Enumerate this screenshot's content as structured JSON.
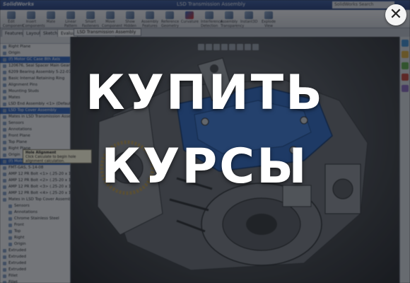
{
  "app": {
    "brand": "SolidWorks",
    "window_title": "LSD Transmission Assembly",
    "search_placeholder": "SolidWorks Search"
  },
  "toolbar": {
    "tools": [
      {
        "label": "Edit Component",
        "active": false
      },
      {
        "label": "Insert Components",
        "active": false
      },
      {
        "label": "Mate",
        "active": false
      },
      {
        "label": "Linear Pattern",
        "active": false
      },
      {
        "label": "Smart Fasteners",
        "active": false
      },
      {
        "label": "Move Component",
        "active": false
      },
      {
        "label": "Show Hidden",
        "active": false
      },
      {
        "label": "Assembly Features",
        "active": false
      },
      {
        "label": "Reference Geometry",
        "active": false
      },
      {
        "label": "Curvature",
        "active": true
      },
      {
        "label": "Interference Detection",
        "active": false
      },
      {
        "label": "Assembly Transparency",
        "active": false
      },
      {
        "label": "Instant3D",
        "active": false
      },
      {
        "label": "Explode View",
        "active": false
      }
    ]
  },
  "panel_tabs": [
    "Features",
    "Layout",
    "Sketch",
    "Evaluate",
    "Office Products"
  ],
  "panel_tab_selected": "Evaluate",
  "document_tab": "LSD Transmission Assembly",
  "tree": {
    "items": [
      {
        "label": "Right Plane",
        "selected": false,
        "indent": false
      },
      {
        "label": "Origin",
        "selected": false,
        "indent": false
      },
      {
        "label": "(f) Motor GC Case 8th Axis",
        "selected": true,
        "indent": false
      },
      {
        "label": "120676, Seal Spacer Main Gear, 5-1",
        "selected": false,
        "indent": false
      },
      {
        "label": "6209 Bearing Assembly 5-22-07",
        "selected": false,
        "indent": false
      },
      {
        "label": "Basic Internal Retaining Ring",
        "selected": false,
        "indent": false
      },
      {
        "label": "Alignment Pins",
        "selected": false,
        "indent": false
      },
      {
        "label": "Mounting Studs",
        "selected": false,
        "indent": false
      },
      {
        "label": "Mates",
        "selected": false,
        "indent": false
      },
      {
        "label": "LSD End Assembly <1> (Default<Display",
        "selected": false,
        "indent": false
      },
      {
        "label": "LSD Top Cover Assembly",
        "selected": true,
        "indent": false
      },
      {
        "label": "Mates in LSD Transmission Assembly",
        "selected": false,
        "indent": false
      },
      {
        "label": "Sensors",
        "selected": false,
        "indent": false
      },
      {
        "label": "Annotations",
        "selected": false,
        "indent": false
      },
      {
        "label": "Front Plane",
        "selected": false,
        "indent": false
      },
      {
        "label": "Top Plane",
        "selected": false,
        "indent": false
      },
      {
        "label": "Right Plane",
        "selected": false,
        "indent": false
      },
      {
        "label": "Origin",
        "selected": false,
        "indent": false
      },
      {
        "label": "(f) Motor Top Cover Bar 8, 5-14",
        "selected": true,
        "indent": false
      },
      {
        "label": "FMT-GAS, 5-14-08",
        "selected": false,
        "indent": false
      },
      {
        "label": "AMP 12 PR Bolt <1> (.25-20 x 1.50)",
        "selected": false,
        "indent": false
      },
      {
        "label": "AMP 12 PR Bolt <2> (.25-20 x 1.50)",
        "selected": false,
        "indent": false
      },
      {
        "label": "AMP 12 PR Bolt <3> (.25-20 x 1.50)",
        "selected": false,
        "indent": false
      },
      {
        "label": "AMP 12 PR Bolt <4> (.25-20 x 1.50)",
        "selected": false,
        "indent": false
      },
      {
        "label": "Mates in LSD Top Cover Assembly",
        "selected": false,
        "indent": false
      },
      {
        "label": "Sensors",
        "selected": false,
        "indent": true
      },
      {
        "label": "Annotations",
        "selected": false,
        "indent": true
      },
      {
        "label": "Chrome Stainless Steel",
        "selected": false,
        "indent": true
      },
      {
        "label": "Front",
        "selected": false,
        "indent": true
      },
      {
        "label": "Top",
        "selected": false,
        "indent": true
      },
      {
        "label": "Right",
        "selected": false,
        "indent": true
      },
      {
        "label": "Origin",
        "selected": false,
        "indent": true
      },
      {
        "label": "Extruded",
        "selected": false,
        "indent": false
      },
      {
        "label": "Extruded",
        "selected": false,
        "indent": false
      },
      {
        "label": "Extruded",
        "selected": false,
        "indent": false
      },
      {
        "label": "Extruded",
        "selected": false,
        "indent": false
      },
      {
        "label": "Fillet",
        "selected": false,
        "indent": false
      },
      {
        "label": "Fillet",
        "selected": false,
        "indent": false
      }
    ]
  },
  "tooltip": {
    "title": "Hole Alignment",
    "body": "Click Calculate to begin hole alignment calculation."
  },
  "overlay": {
    "line1": "КУПИТЬ",
    "line2": "КУРСЫ",
    "close_symbol": "✕"
  },
  "colors": {
    "model_blue": "#2f6fd0",
    "model_metal": "#9aa0a8",
    "selection": "#3169c6",
    "titlebar": "#2a4687"
  }
}
